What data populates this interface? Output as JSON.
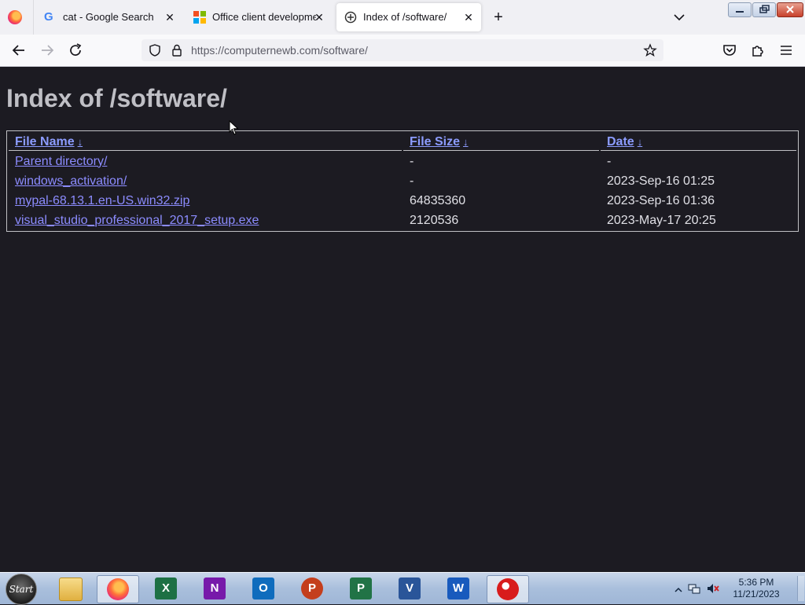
{
  "browser": {
    "tabs": [
      {
        "title": "cat - Google Search",
        "favicon": "google-icon"
      },
      {
        "title": "Office client developmen",
        "favicon": "microsoft-icon"
      },
      {
        "title": "Index of /software/",
        "favicon": "directory-icon",
        "active": true
      }
    ],
    "url_host": "https://computernewb.com",
    "url_path": "/software/"
  },
  "page": {
    "heading": "Index of /software/",
    "columns": [
      "File Name",
      "File Size",
      "Date"
    ],
    "sort_indicator": "↓",
    "rows": [
      {
        "name": "Parent directory/",
        "size": "-",
        "date": "-"
      },
      {
        "name": "windows_activation/",
        "size": "-",
        "date": "2023-Sep-16 01:25"
      },
      {
        "name": "mypal-68.13.1.en-US.win32.zip",
        "size": "64835360",
        "date": "2023-Sep-16 01:36"
      },
      {
        "name": "visual_studio_professional_2017_setup.exe",
        "size": "2120536",
        "date": "2023-May-17 20:25"
      }
    ]
  },
  "taskbar": {
    "start_label": "Start",
    "apps": [
      {
        "name": "file-explorer",
        "letter": ""
      },
      {
        "name": "firefox",
        "letter": "",
        "active": true
      },
      {
        "name": "excel",
        "letter": "X",
        "color": "#1d7044"
      },
      {
        "name": "onenote",
        "letter": "N",
        "color": "#7719aa"
      },
      {
        "name": "outlook",
        "letter": "O",
        "color": "#0f6cbd"
      },
      {
        "name": "powerpoint",
        "letter": "P",
        "color": "#c43e1c"
      },
      {
        "name": "project",
        "letter": "P",
        "color": "#217346"
      },
      {
        "name": "visio",
        "letter": "V",
        "color": "#2a5599"
      },
      {
        "name": "word",
        "letter": "W",
        "color": "#185abd"
      },
      {
        "name": "soccer-app",
        "letter": "",
        "active": true
      }
    ],
    "time": "5:36 PM",
    "date": "11/21/2023"
  }
}
